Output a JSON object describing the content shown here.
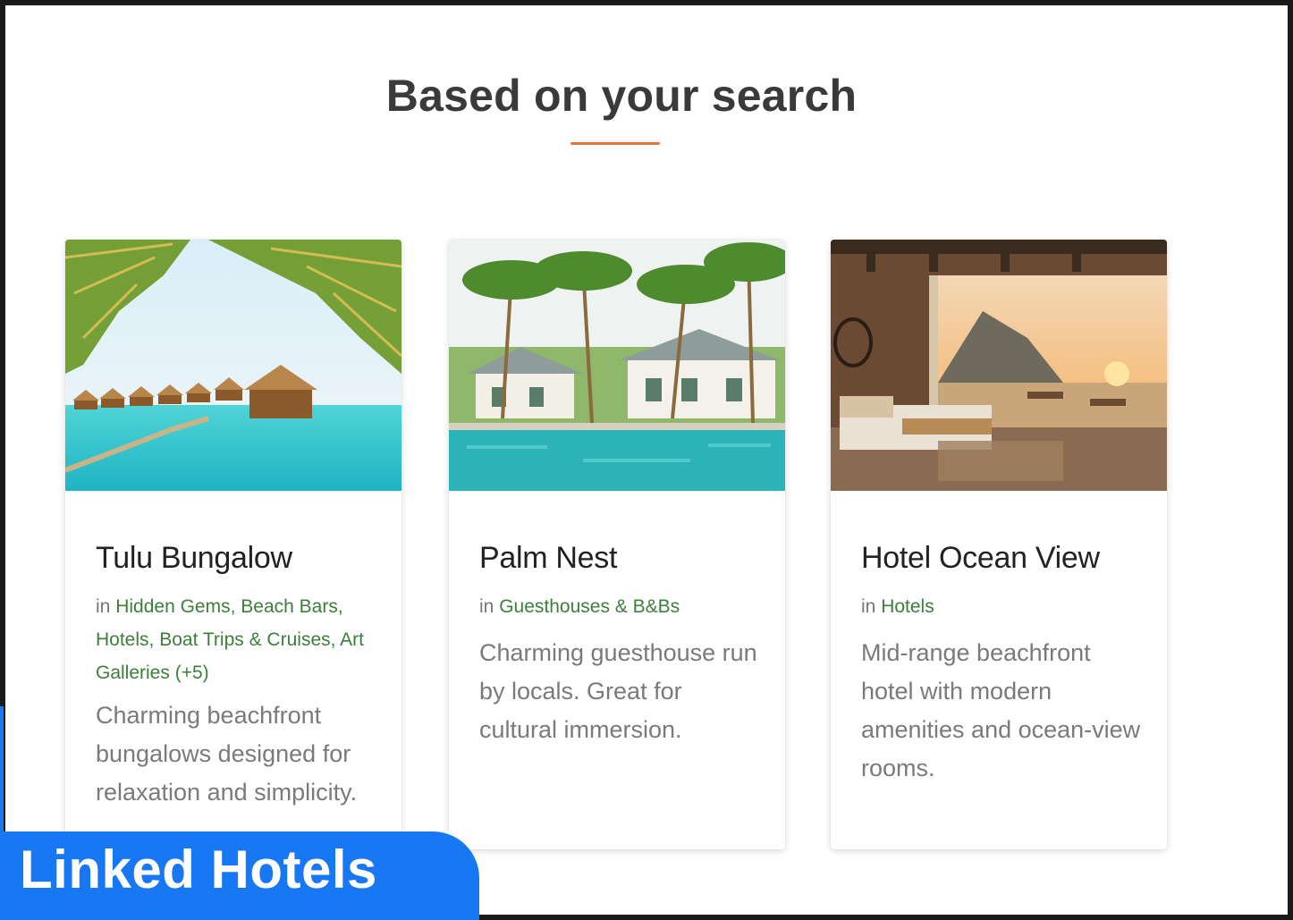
{
  "section": {
    "title": "Based on your search"
  },
  "cards": [
    {
      "title": "Tulu Bungalow",
      "in_prefix": "in",
      "categories": [
        "Hidden Gems",
        "Beach Bars",
        "Hotels",
        "Boat Trips & Cruises",
        "Art Galleries"
      ],
      "more": "(+5)",
      "description": "Charming beachfront bungalows designed for relaxation and simplicity.",
      "image": "overwater-bungalows-photo"
    },
    {
      "title": "Palm Nest",
      "in_prefix": "in",
      "categories": [
        "Guesthouses & B&Bs"
      ],
      "more": "",
      "description": "Charming guesthouse run by locals. Great for cultural immersion.",
      "image": "palm-pool-guesthouse-photo"
    },
    {
      "title": "Hotel Ocean View",
      "in_prefix": "in",
      "categories": [
        "Hotels"
      ],
      "more": "",
      "description": "Mid-range beachfront hotel with modern amenities and ocean-view rooms.",
      "image": "ocean-view-bedroom-photo"
    }
  ],
  "badge": {
    "label": "Linked Hotels"
  },
  "colors": {
    "accent": "#e8733a",
    "category_link": "#3c7f3a",
    "badge": "#1877f2"
  }
}
